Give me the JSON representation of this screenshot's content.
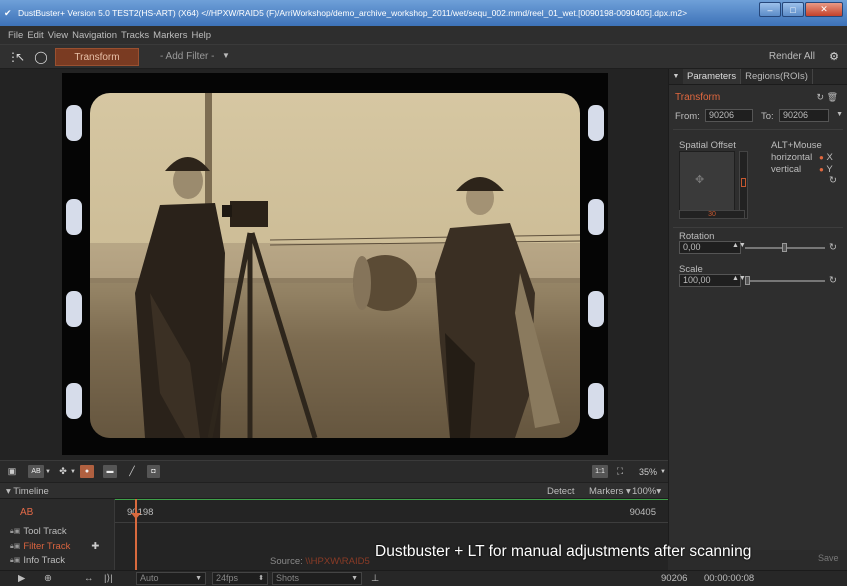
{
  "window": {
    "title": "DustBuster+ Version 5.0 TEST2(HS-ART) (X64) <//HPXW/RAID5 (F)/ArriWorkshop/demo_archive_workshop_2011/wet/sequ_002.mmd/reel_01_wet.[0090198-0090405].dpx.m2>"
  },
  "menu": [
    "File",
    "Edit",
    "View",
    "Navigation",
    "Tracks",
    "Markers",
    "Help"
  ],
  "toolbar": {
    "active_tool": "Transform",
    "add_filter": "- Add Filter -",
    "render_all": "Render All"
  },
  "viewer_tools": {
    "box1": "AB",
    "fit": "1:1",
    "zoom": "35%"
  },
  "timeline": {
    "label": "Timeline",
    "detect": "Detect",
    "markers": "Markers",
    "zoom": "100%",
    "ab": "AB",
    "start_frame": "90198",
    "end_frame": "90405",
    "tracks": [
      "Tool Track",
      "Filter Track",
      "Info Track"
    ],
    "source_label": "Source:",
    "source_value": "\\\\HPXW\\RAID5"
  },
  "panel": {
    "tabs": [
      "Parameters",
      "Regions(ROIs)"
    ],
    "title": "Transform",
    "from_label": "From:",
    "from_value": "90206",
    "to_label": "To:",
    "to_value": "90206",
    "spatial_offset_label": "Spatial Offset",
    "alt_mouse_label": "ALT+Mouse",
    "horizontal_label": "horizontal",
    "vertical_label": "vertical",
    "x_label": "X",
    "y_label": "Y",
    "offset_value": "30",
    "rotation_label": "Rotation",
    "rotation_value": "0,00",
    "rotation_level": 0.5,
    "scale_label": "Scale",
    "scale_value": "100,00",
    "scale_level": 0.0,
    "save": "Save"
  },
  "statusbar": {
    "auto": "Auto",
    "fps": "24fps",
    "shots": "Shots",
    "frame": "90206",
    "timecode": "00:00:00:08"
  },
  "caption": "Dustbuster + LT for manual adjustments after scanning",
  "colors": {
    "accent": "#e0683f",
    "titlebar": "#3d72b8"
  }
}
